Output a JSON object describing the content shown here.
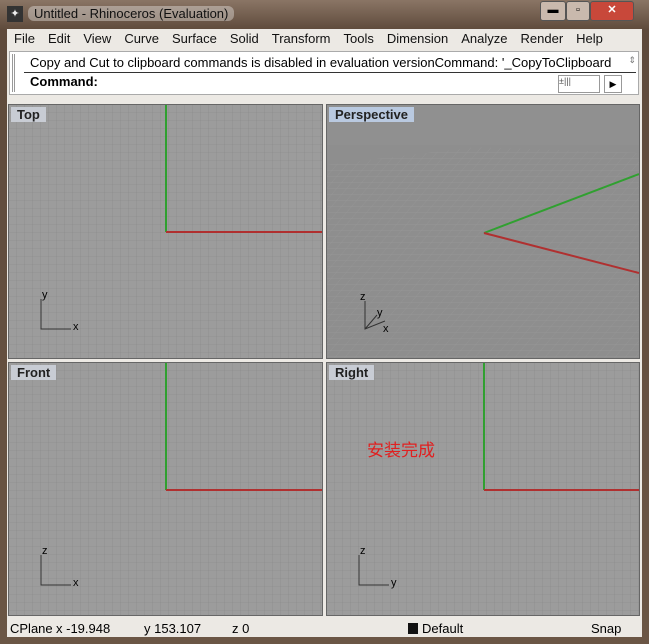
{
  "window": {
    "title": "Untitled - Rhinoceros (Evaluation)",
    "controls": [
      "minimize",
      "maximize",
      "close"
    ]
  },
  "menu": [
    "File",
    "Edit",
    "View",
    "Curve",
    "Surface",
    "Solid",
    "Transform",
    "Tools",
    "Dimension",
    "Analyze",
    "Render",
    "Help"
  ],
  "command": {
    "history": "Copy and Cut to clipboard commands is disabled in evaluation versionCommand: '_CopyToClipboard",
    "prompt": "Command:"
  },
  "viewports": {
    "top": "Top",
    "perspective": "Perspective",
    "front": "Front",
    "right": "Right"
  },
  "axes": {
    "x": "x",
    "y": "y",
    "z": "z"
  },
  "overlay_text": "安装完成",
  "status": {
    "cplane": "CPlane",
    "x": "x -19.948",
    "y": "y 153.107",
    "z": "z 0",
    "layer": "Default",
    "snap": "Snap"
  },
  "colors": {
    "x_axis": "#b03030",
    "y_axis": "#30a030",
    "grid": "#9c9c9c"
  }
}
